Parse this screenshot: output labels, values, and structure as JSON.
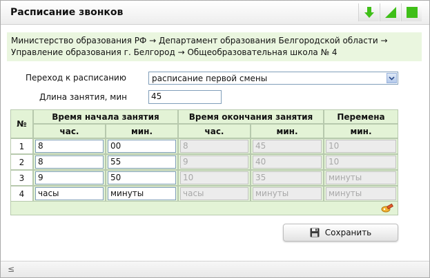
{
  "window": {
    "title": "Расписание звонков",
    "colors": {
      "accent_green": "#3fbf18",
      "header_bg": "#e3f3d6",
      "breadcrumb_bg": "#eaf6df"
    },
    "controls": [
      "download-arrow-icon",
      "resize-corner-icon",
      "maximize-square-icon"
    ]
  },
  "breadcrumb": {
    "line1": "Министерство образования РФ → Департамент образования Белгородской области →",
    "line2": "Управление образования г. Белгород → Общеобразовательная школа № 4"
  },
  "form": {
    "schedule_label": "Переход к расписанию",
    "schedule_value": "расписание первой смены",
    "length_label": "Длина занятия, мин",
    "length_value": "45"
  },
  "table": {
    "num_header": "№",
    "start_header": "Время начала занятия",
    "end_header": "Время окончания занятия",
    "break_header": "Перемена",
    "hour_sub": "час.",
    "min_sub": "мин.",
    "rows": [
      {
        "num": "1",
        "start_h": "8",
        "start_m": "00",
        "end_h": "8",
        "end_m": "45",
        "brk": "10"
      },
      {
        "num": "2",
        "start_h": "8",
        "start_m": "55",
        "end_h": "9",
        "end_m": "40",
        "brk": "10"
      },
      {
        "num": "3",
        "start_h": "9",
        "start_m": "50",
        "end_h": "10",
        "end_m": "35",
        "brk": "минуты"
      },
      {
        "num": "4",
        "start_h": "часы",
        "start_m": "минуты",
        "end_h": "часы",
        "end_m": "минуты",
        "brk": "минуты"
      }
    ]
  },
  "actions": {
    "save_label": "Сохранить"
  },
  "statusbar": {
    "left": "≤"
  }
}
